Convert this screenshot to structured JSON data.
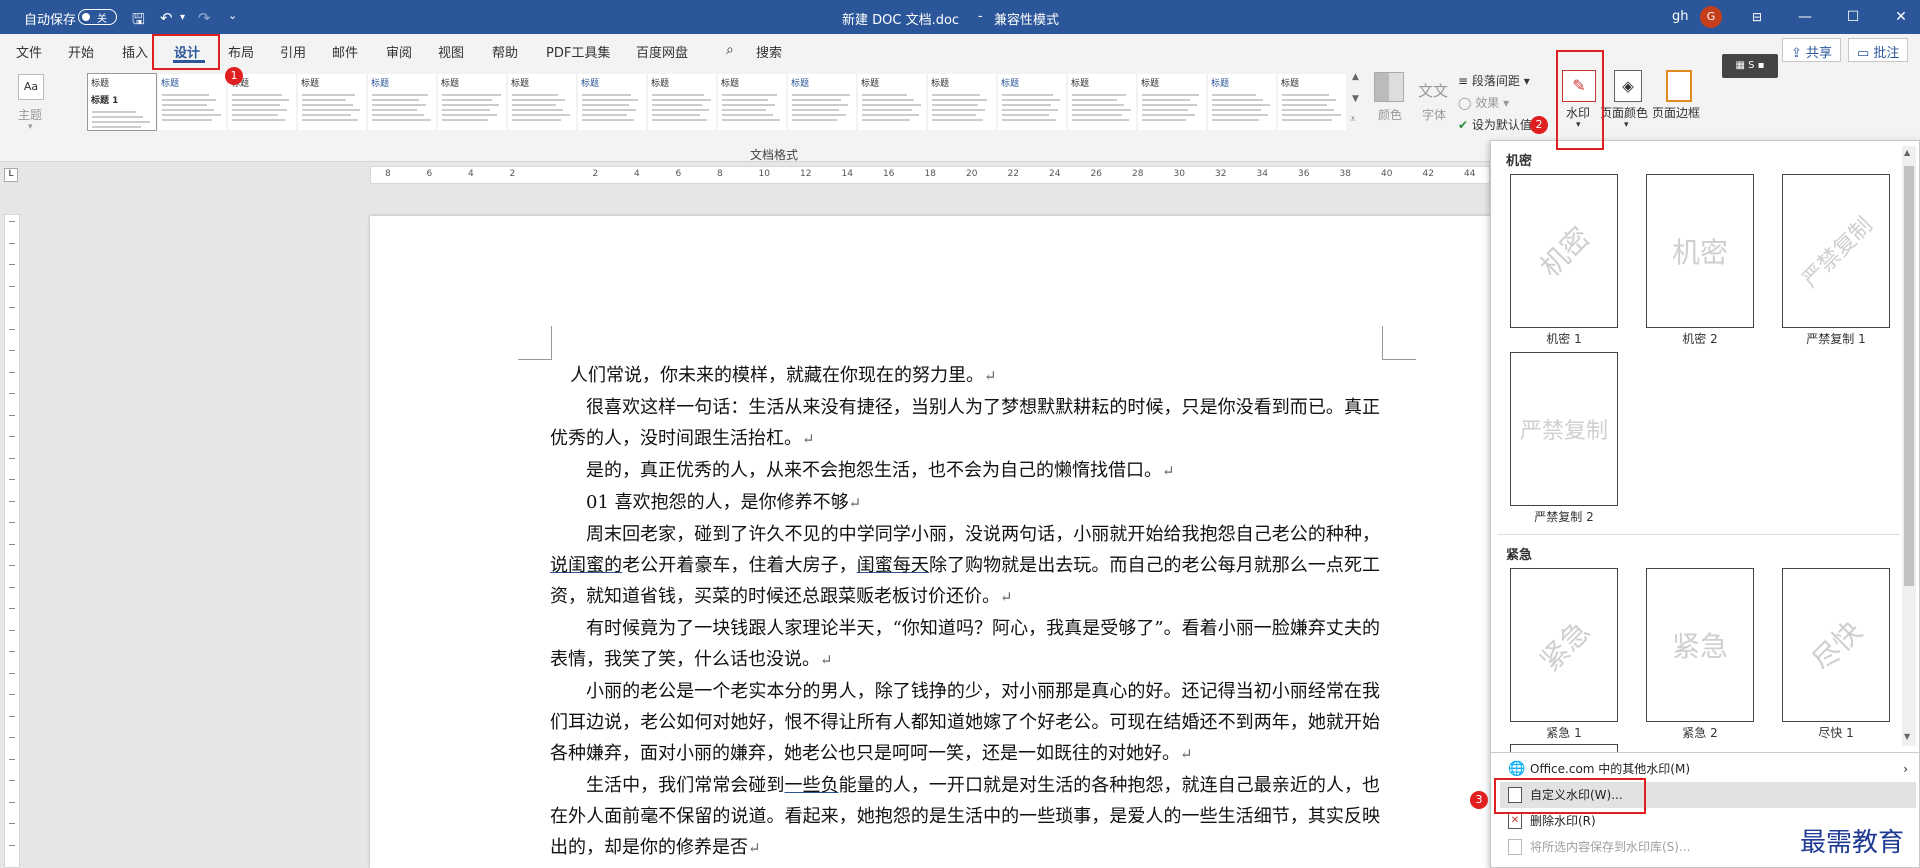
{
  "titlebar": {
    "autosave_label": "自动保存",
    "autosave_state": "关",
    "doc_title": "新建 DOC 文档.doc",
    "separator": "-",
    "mode": "兼容性模式",
    "user_name": "gh",
    "avatar_letter": "G",
    "color": "#2b579a"
  },
  "tabs": [
    "文件",
    "开始",
    "插入",
    "设计",
    "布局",
    "引用",
    "邮件",
    "审阅",
    "视图",
    "帮助",
    "PDF工具集",
    "百度网盘"
  ],
  "active_tab": "设计",
  "search_label": "搜索",
  "share_label": "共享",
  "comment_label": "批注",
  "ribbon": {
    "theme_label": "主题",
    "gallery_titles": [
      "标题",
      "标题",
      "标题",
      "标题",
      "标题",
      "标题",
      "标题",
      "标题",
      "标题",
      "标题",
      "标题",
      "标题",
      "标题",
      "标题",
      "标题",
      "标题",
      "标题",
      "标题"
    ],
    "gallery_first_sub": "标题 1",
    "colors_label": "颜色",
    "fonts_label": "字体",
    "fonts_glyph": "文文",
    "paragraph_spacing": "段落间距",
    "effects": "效果",
    "set_default": "设为默认值",
    "watermark_label": "水印",
    "page_color_label": "页面颜色",
    "page_border_label": "页面边框",
    "group_label": "文档格式"
  },
  "ruler_ticks": [
    "8",
    "6",
    "4",
    "2",
    "",
    "2",
    "4",
    "6",
    "8",
    "10",
    "12",
    "14",
    "16",
    "18",
    "20",
    "22",
    "24",
    "26",
    "28",
    "30",
    "32",
    "34",
    "36",
    "38",
    "40",
    "42",
    "44"
  ],
  "document": {
    "paragraphs": [
      {
        "text": "人们常说，你未来的模样，就藏在你现在的努力里。",
        "mark": "↵"
      },
      {
        "text": "很喜欢这样一句话：生活从来没有捷径，当别人为了梦想默默耕耘的时候，只是你没看到而已。真正优秀的人，没时间跟生活抬杠。",
        "mark": "↵"
      },
      {
        "text": "是的，真正优秀的人，从来不会抱怨生活，也不会为自己的懒惰找借口。",
        "mark": "↵"
      },
      {
        "text": "01  喜欢抱怨的人，是你修养不够",
        "mark": "↵"
      },
      {
        "text_a": "周末回老家，碰到了许久不见的中学同学小丽，没说两句话，小丽就开始给我抱怨自己老公的种种，",
        "u1": "说闺蜜的",
        "text_b": "老公开着豪车，住着大房子，",
        "u2": "闺蜜每天",
        "text_c": "除了购物就是出去玩。而自己的老公每月就那么一点死工资，就知道省钱，买菜的时候还总跟菜贩老板讨价还价。",
        "mark": "↵"
      },
      {
        "text": "有时候竟为了一块钱跟人家理论半天，“你知道吗？阿心，我真是受够了”。看着小丽一脸嫌弃丈夫的表情，我笑了笑，什么话也没说。",
        "mark": "↵"
      },
      {
        "text": "小丽的老公是一个老实本分的男人，除了钱挣的少，对小丽那是真心的好。还记得当初小丽经常在我们耳边说，老公如何对她好，恨不得让所有人都知道她嫁了个好老公。可现在结婚还不到两年，她就开始各种嫌弃，面对小丽的嫌弃，她老公也只是呵呵一笑，还是一如既往的对她好。",
        "mark": "↵"
      },
      {
        "text_a": "生活中，我们常常会碰到",
        "u1": "一些负",
        "text_b": "能量的人，一开口就是对生活的各种抱怨，就连自己最亲近的人，也在外人面前毫不保留的说道。看起来，她抱怨的是生活中的一些琐事，是爱人的一些生活细节，其实反映出的，却是你的修养是否",
        "mark": "↵"
      }
    ]
  },
  "watermark_panel": {
    "section1": "机密",
    "section2": "紧急",
    "items": [
      {
        "caption": "机密 1",
        "text": "机密",
        "style": "diagonal"
      },
      {
        "caption": "机密 2",
        "text": "机密",
        "style": "horizontal"
      },
      {
        "caption": "严禁复制 1",
        "text": "严禁复制",
        "style": "diagonal"
      },
      {
        "caption": "严禁复制 2",
        "text": "严禁复制",
        "style": "horizontal"
      },
      {
        "caption": "紧急 1",
        "text": "紧急",
        "style": "diagonal"
      },
      {
        "caption": "紧急 2",
        "text": "紧急",
        "style": "horizontal"
      },
      {
        "caption": "尽快 1",
        "text": "尽快",
        "style": "diagonal"
      }
    ],
    "menu": [
      {
        "label": "Office.com 中的其他水印(M)",
        "enabled": true
      },
      {
        "label": "自定义水印(W)...",
        "enabled": true
      },
      {
        "label": "删除水印(R)",
        "enabled": true
      },
      {
        "label": "将所选内容保存到水印库(S)...",
        "enabled": false
      }
    ]
  },
  "annotations": [
    "1",
    "2",
    "3"
  ],
  "brand_text": "最需教育"
}
